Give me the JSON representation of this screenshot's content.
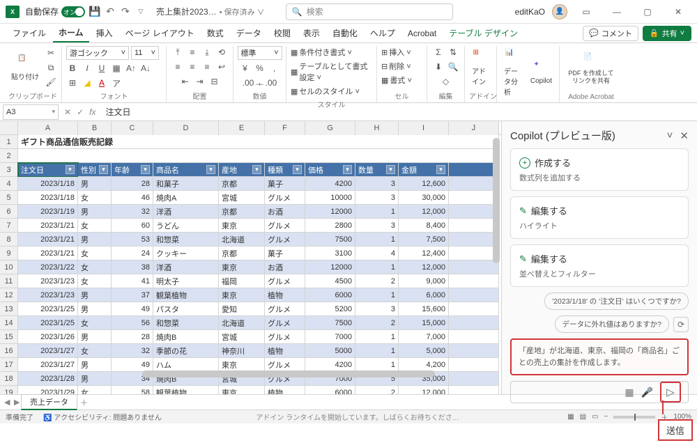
{
  "titlebar": {
    "autosave_label": "自動保存",
    "autosave_toggle": "オン",
    "filename": "売上集計2023…",
    "saved_state": "• 保存済み ∨",
    "search_placeholder": "検索",
    "username": "editKaO"
  },
  "tabs": {
    "file": "ファイル",
    "home": "ホーム",
    "insert": "挿入",
    "page_layout": "ページ レイアウト",
    "formulas": "数式",
    "data": "データ",
    "review": "校閲",
    "view": "表示",
    "automate": "自動化",
    "help": "ヘルプ",
    "acrobat": "Acrobat",
    "table_design": "テーブル デザイン",
    "comments": "コメント",
    "share": "共有"
  },
  "ribbon": {
    "clipboard": {
      "paste": "貼り付け",
      "label": "クリップボード"
    },
    "font": {
      "name": "游ゴシック",
      "size": "11",
      "label": "フォント"
    },
    "align": {
      "label": "配置",
      "wrap": "段"
    },
    "number": {
      "format": "標準",
      "label": "数値"
    },
    "styles": {
      "cond": "条件付き書式 ˅",
      "table": "テーブルとして書式設定 ˅",
      "cell": "セルのスタイル ˅",
      "label": "スタイル"
    },
    "cells": {
      "insert": "挿入 ˅",
      "delete": "削除 ˅",
      "format": "書式 ˅",
      "label": "セル"
    },
    "editing": {
      "label": "編集"
    },
    "addin": {
      "btn": "アドイン",
      "label": "アドイン"
    },
    "analysis": {
      "btn": "データ分析",
      "copilot": "Copilot"
    },
    "acrobat": {
      "btn": "PDF を作成してリンクを共有",
      "label": "Adobe Acrobat"
    }
  },
  "namebox": "A3",
  "formula": "注文日",
  "sheet": {
    "title": "ギフト商品通信販売記録",
    "columns": [
      "A",
      "B",
      "C",
      "D",
      "E",
      "F",
      "G",
      "H",
      "I",
      "J"
    ],
    "headers": [
      "注文日",
      "性別",
      "年齢",
      "商品名",
      "産地",
      "種類",
      "価格",
      "数量",
      "金額"
    ],
    "rows": [
      [
        "2023/1/18",
        "男",
        "28",
        "和菓子",
        "京都",
        "菓子",
        "4200",
        "3",
        "12,600"
      ],
      [
        "2023/1/18",
        "女",
        "46",
        "焼肉A",
        "宮城",
        "グルメ",
        "10000",
        "3",
        "30,000"
      ],
      [
        "2023/1/19",
        "男",
        "32",
        "洋酒",
        "京都",
        "お酒",
        "12000",
        "1",
        "12,000"
      ],
      [
        "2023/1/21",
        "女",
        "60",
        "うどん",
        "東京",
        "グルメ",
        "2800",
        "3",
        "8,400"
      ],
      [
        "2023/1/21",
        "男",
        "53",
        "和惣菜",
        "北海道",
        "グルメ",
        "7500",
        "1",
        "7,500"
      ],
      [
        "2023/1/21",
        "女",
        "24",
        "クッキー",
        "京都",
        "菓子",
        "3100",
        "4",
        "12,400"
      ],
      [
        "2023/1/22",
        "女",
        "38",
        "洋酒",
        "東京",
        "お酒",
        "12000",
        "1",
        "12,000"
      ],
      [
        "2023/1/23",
        "女",
        "41",
        "明太子",
        "福岡",
        "グルメ",
        "4500",
        "2",
        "9,000"
      ],
      [
        "2023/1/23",
        "男",
        "37",
        "観葉植物",
        "東京",
        "植物",
        "6000",
        "1",
        "6,000"
      ],
      [
        "2023/1/25",
        "男",
        "49",
        "パスタ",
        "愛知",
        "グルメ",
        "5200",
        "3",
        "15,600"
      ],
      [
        "2023/1/25",
        "女",
        "56",
        "和惣菜",
        "北海道",
        "グルメ",
        "7500",
        "2",
        "15,000"
      ],
      [
        "2023/1/26",
        "男",
        "28",
        "焼肉B",
        "宮城",
        "グルメ",
        "7000",
        "1",
        "7,000"
      ],
      [
        "2023/1/27",
        "女",
        "32",
        "季節の花",
        "神奈川",
        "植物",
        "5000",
        "1",
        "5,000"
      ],
      [
        "2023/1/27",
        "男",
        "49",
        "ハム",
        "東京",
        "グルメ",
        "4200",
        "1",
        "4,200"
      ],
      [
        "2023/1/28",
        "男",
        "34",
        "焼肉B",
        "宮城",
        "グルメ",
        "7000",
        "5",
        "35,000"
      ],
      [
        "2023/1/29",
        "女",
        "58",
        "観葉植物",
        "東京",
        "植物",
        "6000",
        "2",
        "12,000"
      ]
    ],
    "tab_name": "売上データ"
  },
  "copilot": {
    "title": "Copilot (プレビュー版)",
    "card1_t": "作成する",
    "card1_s": "数式列を追加する",
    "card2_t": "編集する",
    "card2_s": "ハイライト",
    "card3_t": "編集する",
    "card3_s": "並べ替えとフィルター",
    "sugg1": "'2023/1/18' の '注文日' はいくつですか?",
    "sugg2": "データに外れ値はありますか?",
    "prompt": "「産地」が北海道、東京、福岡の「商品名」ごとの売上の集計を作成します。"
  },
  "status": {
    "ready": "準備完了",
    "acc": "アクセシビリティ: 問題ありません",
    "addin_msg": "アドイン ランタイムを開始しています。しばらくお待ちくださ…",
    "zoom": "100%"
  },
  "callout": "送信"
}
